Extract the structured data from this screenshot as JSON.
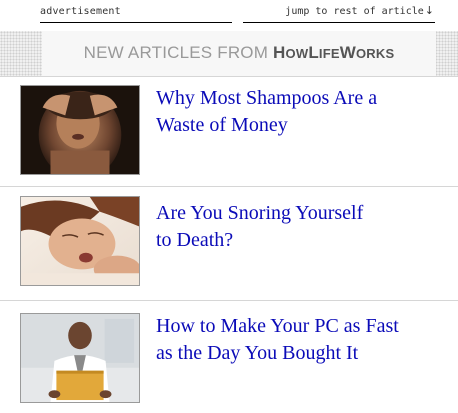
{
  "topbar": {
    "ad_label": "advertisement",
    "jump_label": "jump to rest of article",
    "jump_arrow": "↓"
  },
  "header": {
    "prefix": "NEW ARTICLES FROM ",
    "brand_parts": [
      "H",
      "OW",
      "L",
      "IFE",
      "W",
      "ORKS"
    ]
  },
  "articles": [
    {
      "title_line1": "Why Most Shampoos Are a",
      "title_line2": "Waste of Money",
      "thumb_icon": "woman-shampoo-photo"
    },
    {
      "title_line1": "Are You Snoring Yourself",
      "title_line2": "to Death?",
      "thumb_icon": "woman-sleeping-photo"
    },
    {
      "title_line1": "How to Make Your PC as Fast",
      "title_line2": "as the Day You Bought It",
      "thumb_icon": "man-laptop-photo"
    }
  ],
  "colors": {
    "link": "#0b0bb8",
    "header_text": "#999999",
    "brand_text": "#555555",
    "divider": "#d6d6d6"
  }
}
